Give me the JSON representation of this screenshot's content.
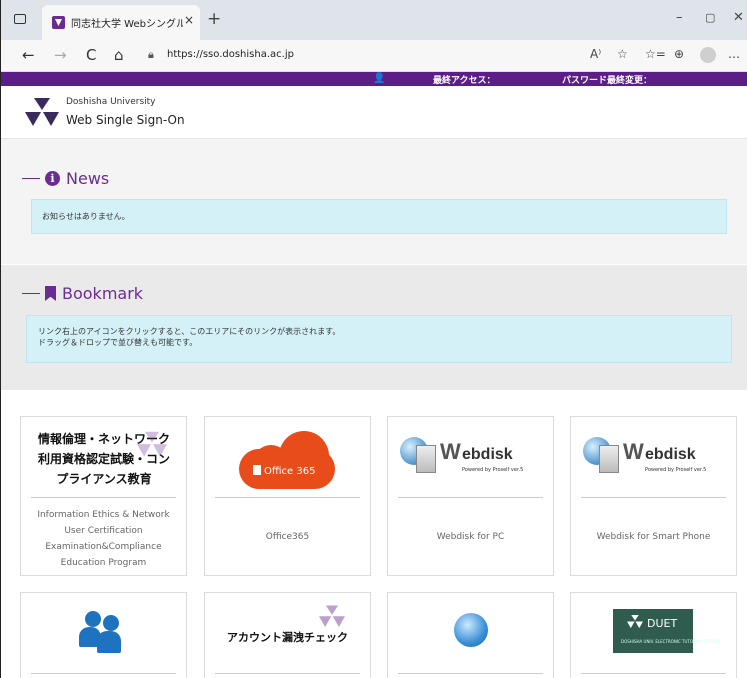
{
  "browser": {
    "tab_title": "同志社大学 Webシングルサインオ",
    "tab_close": "×",
    "new_tab": "+",
    "window_controls": [
      "–",
      "▢",
      "✕"
    ],
    "url": "https://sso.doshisha.ac.jp",
    "nav": {
      "back": "←",
      "forward": "→",
      "reload": "C",
      "home": "⌂"
    },
    "toolbar_icons": [
      "A⁾",
      "☆",
      "☆=",
      "⊕",
      "…"
    ]
  },
  "topbar": {
    "user_icon": "👤",
    "last_access_label": "最終アクセス：",
    "password_changed_label": "パスワード最終変更："
  },
  "header": {
    "university": "Doshisha University",
    "system_name": "Web Single Sign-On"
  },
  "news": {
    "title": "News",
    "message": "お知らせはありません。"
  },
  "bookmark": {
    "title": "Bookmark",
    "message_line1": "リンク右上のアイコンをクリックすると、このエリアにそのリンクが表示されます。",
    "message_line2": "ドラッグ＆ドロップで並び替えも可能です。"
  },
  "cards": [
    {
      "title_jp": "情報倫理・ネットワーク利用資格認定試験・コンプライアンス教育",
      "label_lines": [
        "Information Ethics & Network",
        "User Certification",
        "Examination&Compliance",
        "Education Program"
      ]
    },
    {
      "logo_text": "Office 365",
      "label": "Office365"
    },
    {
      "logo_main": "Webdisk",
      "logo_sub": "Powered by Proself ver.5",
      "label": "Webdisk for PC"
    },
    {
      "logo_main": "Webdisk",
      "logo_sub": "Powered by Proself ver.5",
      "label": "Webdisk for Smart Phone"
    },
    {
      "icon": "support-people-icon"
    },
    {
      "title_jp": "アカウント漏洩チェック"
    },
    {
      "icon": "globe-icon"
    },
    {
      "logo_text": "DUET",
      "logo_sub": "DOSHISHA UNIV. ELECTRONIC TUTORIAL SYSTEM"
    }
  ],
  "colors": {
    "purple": "#5b1e86",
    "accent": "#6b2c91",
    "alert_bg": "#d4f1f7",
    "office_orange": "#e84c1a"
  }
}
